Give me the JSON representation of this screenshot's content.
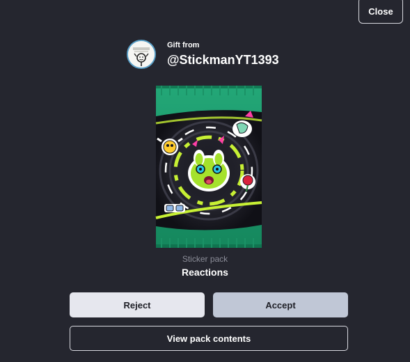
{
  "close_label": "Close",
  "sender": {
    "gift_from_label": "Gift from",
    "username": "@StickmanYT1393",
    "avatar_icon": "stickman-avatar-icon"
  },
  "pack": {
    "type_label": "Sticker pack",
    "name": "Reactions",
    "art_icon": "sticker-pack-art"
  },
  "actions": {
    "reject_label": "Reject",
    "accept_label": "Accept",
    "view_contents_label": "View pack contents"
  },
  "colors": {
    "background": "#25262f",
    "pack_green": "#1f9a6a",
    "reject_bg": "#e6e7ee",
    "accept_bg": "#c0c7d6"
  }
}
